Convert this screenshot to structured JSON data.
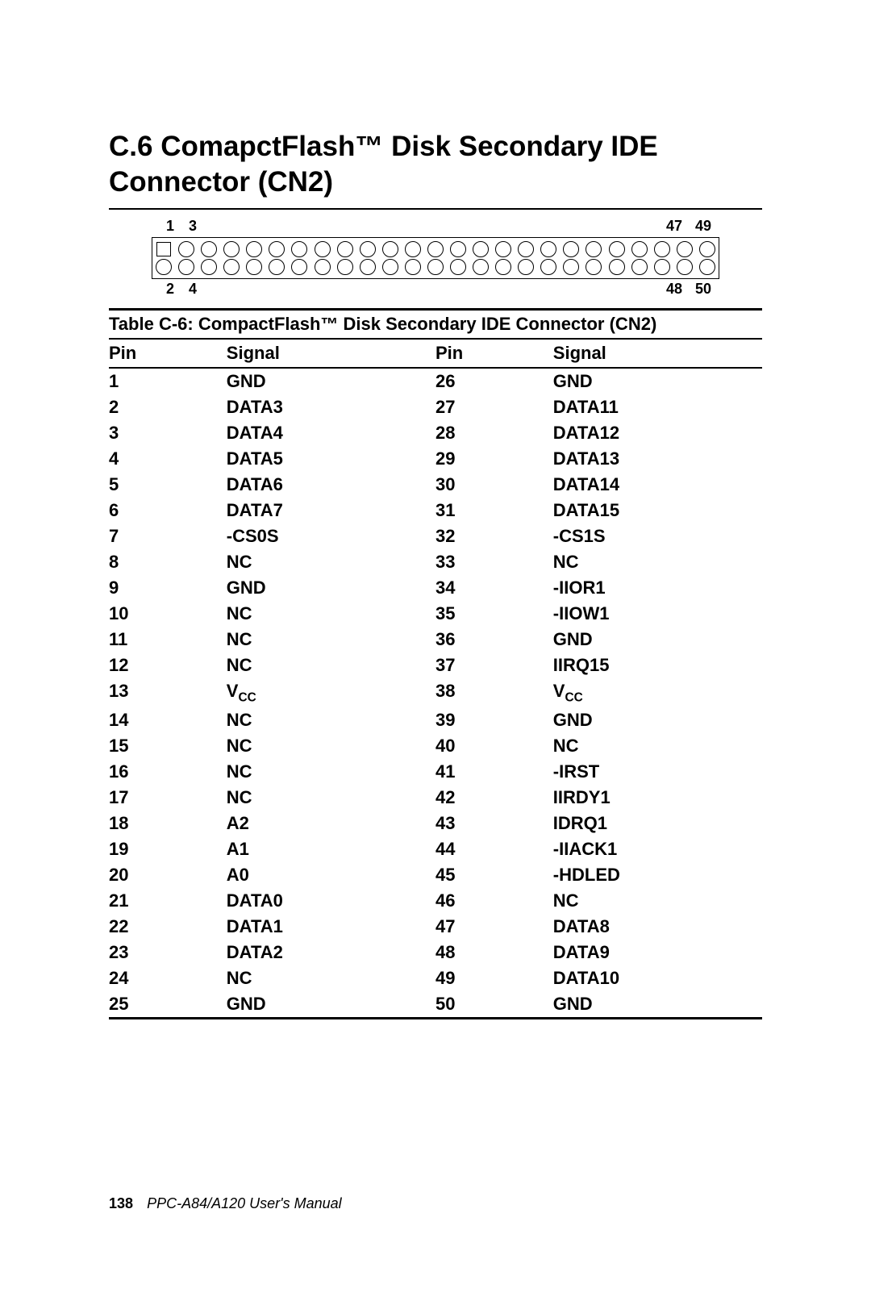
{
  "section_title": "C.6  ComapctFlash™ Disk Secondary IDE Connector (CN2)",
  "diagram_labels": {
    "tl1": "1",
    "tl2": "3",
    "tr1": "47",
    "tr2": "49",
    "bl1": "2",
    "bl2": "4",
    "br1": "48",
    "br2": "50"
  },
  "table_caption": "Table C-6: CompactFlash™ Disk Secondary IDE Connector (CN2)",
  "headers": {
    "pin": "Pin",
    "signal": "Signal"
  },
  "vcc": {
    "base": "V",
    "sub": "CC"
  },
  "chart_data": {
    "type": "table",
    "title": "CompactFlash™ Disk Secondary IDE Connector (CN2)",
    "columns": [
      "Pin",
      "Signal",
      "Pin",
      "Signal"
    ],
    "rows": [
      {
        "p1": "1",
        "s1": "GND",
        "p2": "26",
        "s2": "GND"
      },
      {
        "p1": "2",
        "s1": "DATA3",
        "p2": "27",
        "s2": "DATA11"
      },
      {
        "p1": "3",
        "s1": "DATA4",
        "p2": "28",
        "s2": "DATA12"
      },
      {
        "p1": "4",
        "s1": "DATA5",
        "p2": "29",
        "s2": "DATA13"
      },
      {
        "p1": "5",
        "s1": "DATA6",
        "p2": "30",
        "s2": "DATA14"
      },
      {
        "p1": "6",
        "s1": "DATA7",
        "p2": "31",
        "s2": "DATA15"
      },
      {
        "p1": "7",
        "s1": "-CS0S",
        "p2": "32",
        "s2": "-CS1S"
      },
      {
        "p1": "8",
        "s1": "NC",
        "p2": "33",
        "s2": "NC"
      },
      {
        "p1": "9",
        "s1": "GND",
        "p2": "34",
        "s2": "-IIOR1"
      },
      {
        "p1": "10",
        "s1": "NC",
        "p2": "35",
        "s2": "-IIOW1"
      },
      {
        "p1": "11",
        "s1": "NC",
        "p2": "36",
        "s2": "GND"
      },
      {
        "p1": "12",
        "s1": "NC",
        "p2": "37",
        "s2": "IIRQ15"
      },
      {
        "p1": "13",
        "s1": "VCC",
        "p2": "38",
        "s2": "VCC"
      },
      {
        "p1": "14",
        "s1": "NC",
        "p2": "39",
        "s2": "GND"
      },
      {
        "p1": "15",
        "s1": "NC",
        "p2": "40",
        "s2": "NC"
      },
      {
        "p1": "16",
        "s1": "NC",
        "p2": "41",
        "s2": "-IRST"
      },
      {
        "p1": "17",
        "s1": "NC",
        "p2": "42",
        "s2": "IIRDY1"
      },
      {
        "p1": "18",
        "s1": "A2",
        "p2": "43",
        "s2": "IDRQ1"
      },
      {
        "p1": "19",
        "s1": "A1",
        "p2": "44",
        "s2": "-IIACK1"
      },
      {
        "p1": "20",
        "s1": "A0",
        "p2": "45",
        "s2": "-HDLED"
      },
      {
        "p1": "21",
        "s1": "DATA0",
        "p2": "46",
        "s2": "NC"
      },
      {
        "p1": "22",
        "s1": "DATA1",
        "p2": "47",
        "s2": "DATA8"
      },
      {
        "p1": "23",
        "s1": "DATA2",
        "p2": "48",
        "s2": "DATA9"
      },
      {
        "p1": "24",
        "s1": "NC",
        "p2": "49",
        "s2": "DATA10"
      },
      {
        "p1": "25",
        "s1": "GND",
        "p2": "50",
        "s2": "GND"
      }
    ]
  },
  "footer": {
    "page_number": "138",
    "manual": "PPC-A84/A120 User's Manual"
  }
}
